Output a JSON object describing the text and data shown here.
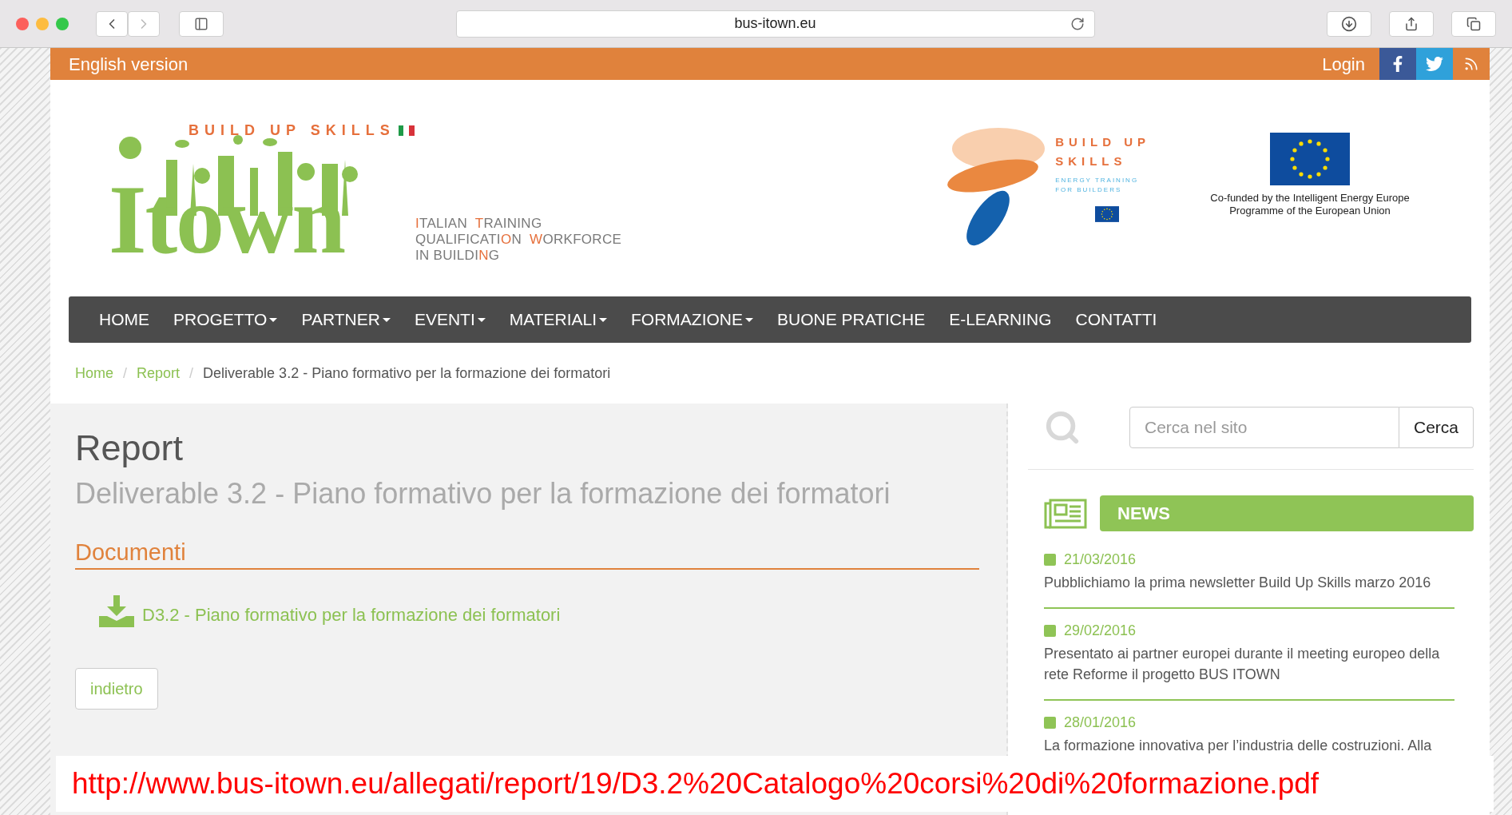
{
  "browser": {
    "address": "bus-itown.eu"
  },
  "topbar": {
    "language_link": "English version",
    "login": "Login"
  },
  "header": {
    "logo": {
      "skills_text": "BUILD UP SKILLS",
      "wordmark": "Itown",
      "tagline": [
        [
          {
            "text": "I",
            "accent": true
          },
          {
            "text": "TALIAN  ",
            "accent": false
          },
          {
            "text": "T",
            "accent": true
          },
          {
            "text": "RAINING",
            "accent": false
          }
        ],
        [
          {
            "text": "QUALIFICATI",
            "accent": false
          },
          {
            "text": "O",
            "accent": true
          },
          {
            "text": "N  ",
            "accent": false
          },
          {
            "text": "W",
            "accent": true
          },
          {
            "text": "ORKFORCE",
            "accent": false
          }
        ],
        [
          {
            "text": "IN BUILDI",
            "accent": false
          },
          {
            "text": "N",
            "accent": true
          },
          {
            "text": "G",
            "accent": false
          }
        ]
      ]
    },
    "bus_logo": {
      "title_line_1": "BUILD UP",
      "title_line_2": "SKILLS",
      "subtitle_line_1": "ENERGY TRAINING",
      "subtitle_line_2": "FOR BUILDERS"
    },
    "eu_caption": "Co-funded by the Intelligent Energy Europe Programme of the European Union"
  },
  "nav": [
    {
      "label": "HOME",
      "dropdown": false
    },
    {
      "label": "PROGETTO",
      "dropdown": true
    },
    {
      "label": "PARTNER",
      "dropdown": true
    },
    {
      "label": "EVENTI",
      "dropdown": true
    },
    {
      "label": "MATERIALI",
      "dropdown": true
    },
    {
      "label": "FORMAZIONE",
      "dropdown": true
    },
    {
      "label": "BUONE PRATICHE",
      "dropdown": false
    },
    {
      "label": "E-LEARNING",
      "dropdown": false
    },
    {
      "label": "CONTATTI",
      "dropdown": false
    }
  ],
  "breadcrumbs": [
    {
      "label": "Home",
      "kind": "link"
    },
    {
      "separator": "/",
      "label": "Report",
      "kind": "link"
    },
    {
      "separator": "/",
      "label": "Deliverable 3.2 - Piano formativo per la formazione dei formatori",
      "kind": "current"
    }
  ],
  "main": {
    "title": "Report",
    "subtitle": "Deliverable 3.2 - Piano formativo per la formazione dei formatori",
    "section_title": "Documenti",
    "document_link": "D3.2 - Piano formativo per la formazione dei formatori",
    "back_button": "indietro"
  },
  "sidebar": {
    "search": {
      "placeholder": "Cerca nel sito",
      "button": "Cerca"
    },
    "news_title": "NEWS",
    "news": [
      {
        "date": "21/03/2016",
        "text": "Pubblichiamo la prima newsletter Build Up Skills marzo 2016"
      },
      {
        "date": "29/02/2016",
        "text": "Presentato ai partner europei durante il meeting europeo della rete Reforme il progetto BUS ITOWN"
      },
      {
        "date": "28/01/2016",
        "text": "La formazione innovativa per l’industria delle costruzioni. Alla"
      }
    ]
  },
  "annotation": "http://www.bus-itown.eu/allegati/report/19/D3.2%20Catalogo%20corsi%20di%20formazione.pdf"
}
